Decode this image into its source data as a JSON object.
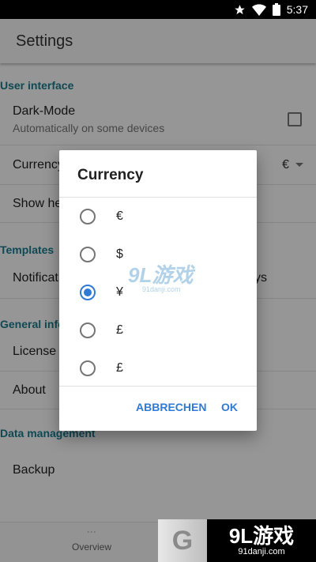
{
  "status_bar": {
    "time": "5:37",
    "icons": [
      "star-icon",
      "wifi-icon",
      "battery-icon"
    ]
  },
  "app_bar": {
    "title": "Settings"
  },
  "sections": {
    "user_interface": {
      "header": "User interface",
      "dark_mode": {
        "title": "Dark-Mode",
        "subtitle": "Automatically on some devices",
        "checked": false
      },
      "currency": {
        "title": "Currency",
        "value": "€"
      },
      "show_help": {
        "title": "Show he"
      }
    },
    "templates": {
      "header": "Templates",
      "notifications": {
        "title": "Notificat",
        "trailing": "ys"
      }
    },
    "general_info": {
      "header": "General info",
      "license": {
        "title": "License"
      },
      "about": {
        "title": "About"
      }
    },
    "data_management": {
      "header": "Data management",
      "backup": {
        "title": "Backup"
      }
    }
  },
  "bottom_nav": {
    "overview_label": "Overview"
  },
  "dialog": {
    "title": "Currency",
    "options": [
      {
        "label": "€",
        "selected": false
      },
      {
        "label": "$",
        "selected": false
      },
      {
        "label": "¥",
        "selected": true
      },
      {
        "label": "£",
        "selected": false
      },
      {
        "label": "£",
        "selected": false
      }
    ],
    "cancel_label": "ABBRECHEN",
    "ok_label": "OK"
  },
  "watermark": {
    "text": "9L游戏",
    "url": "91danji.com"
  },
  "banner": {
    "logo": "G",
    "title": "9L游戏",
    "url": "91danji.com"
  },
  "colors": {
    "accent": "#2f7ad6",
    "section_header": "#1a7a8a",
    "scrim": "rgba(0,0,0,0.40)"
  }
}
